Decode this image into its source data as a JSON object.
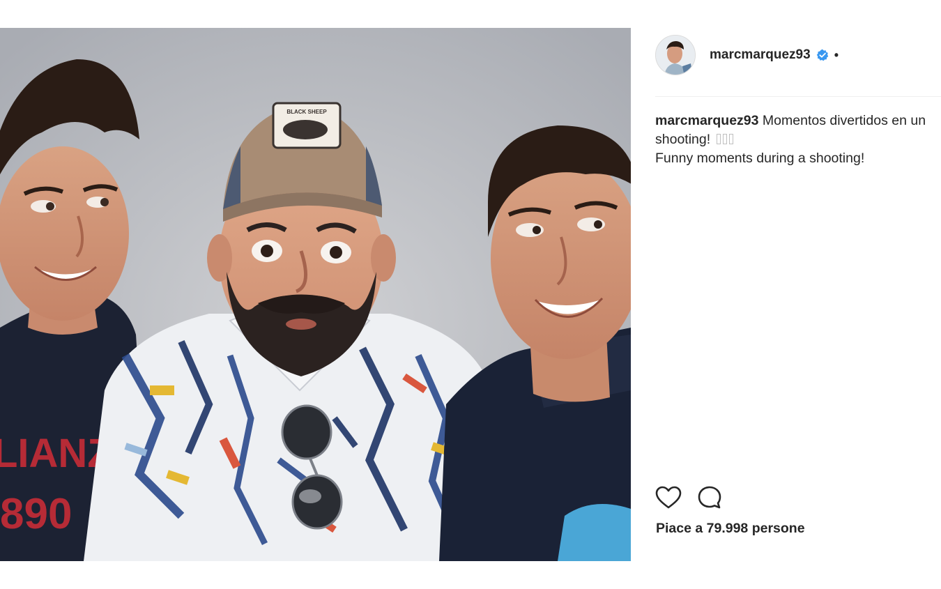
{
  "post": {
    "username": "marcmarquez93",
    "verified": true,
    "separator": "•",
    "caption_user": "marcmarquez93",
    "caption_line1": "Momentos divertidos en un shooting!",
    "caption_line2": "Funny moments during a shooting!",
    "likes_text": "Piace a 79.998 persone",
    "cap_text_on_hat": "BLACK SHEEP",
    "shirt_left_text_1": "LIANZ",
    "shirt_left_text_2": "890"
  },
  "icons": {
    "like": "heart-icon",
    "comment": "comment-bubble-icon",
    "verified": "verified-badge-icon"
  },
  "colors": {
    "text": "#262626",
    "verified_blue": "#3897f0",
    "divider": "#efefef",
    "photo_bg": "#c4c6cb"
  }
}
